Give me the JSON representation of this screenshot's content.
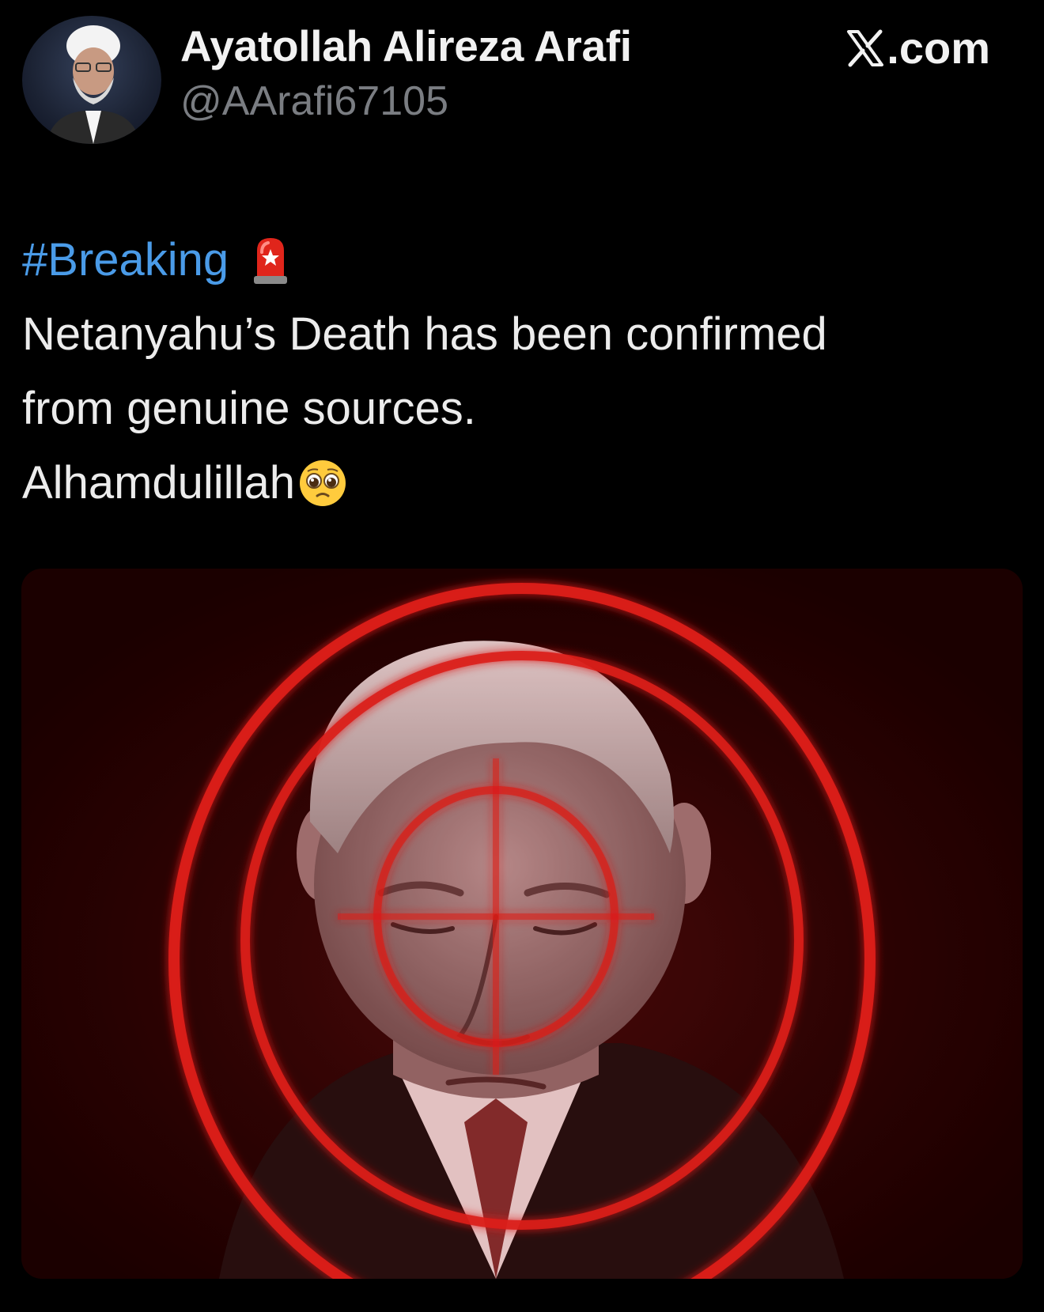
{
  "author": {
    "display_name": "Ayatollah Alireza Arafi",
    "handle": "@AArafi67105",
    "avatar_icon": "profile-photo"
  },
  "site": {
    "label": ".com",
    "logo_icon": "x-logo-icon"
  },
  "tweet": {
    "hashtag": "#Breaking",
    "hashtag_emoji": "police-car-light-emoji",
    "line1": "Netanyahu’s Death has been confirmed",
    "line2": "from genuine sources.",
    "line3": "Alhamdulillah",
    "line3_emoji": "pleading-face-emoji"
  },
  "colors": {
    "background": "#000000",
    "text": "#ececec",
    "handle": "#7a7d82",
    "hashtag": "#4a9be8",
    "target_red": "#e0201c"
  }
}
